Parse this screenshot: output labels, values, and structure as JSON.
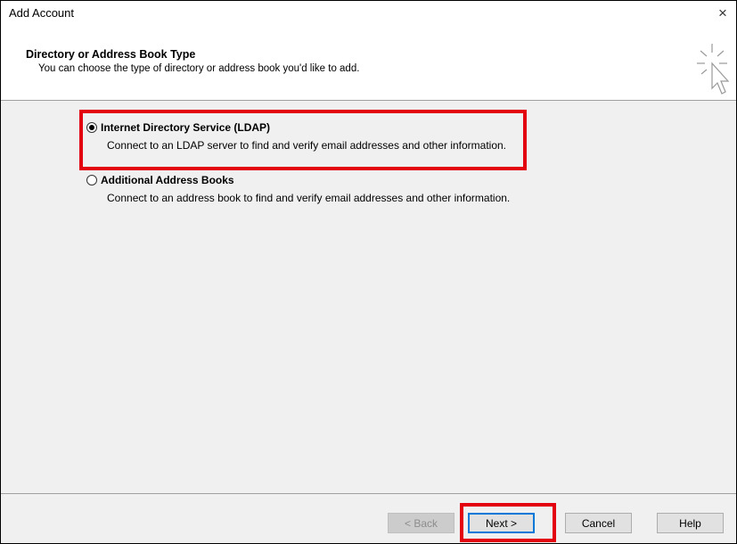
{
  "window": {
    "title": "Add Account",
    "close_symbol": "×"
  },
  "header": {
    "title": "Directory or Address Book Type",
    "subtitle": "You can choose the type of directory or address book you'd like to add."
  },
  "options": [
    {
      "label": "Internet Directory Service (LDAP)",
      "description": "Connect to an LDAP server to find and verify email addresses and other information.",
      "selected": true
    },
    {
      "label": "Additional Address Books",
      "description": "Connect to an address book to find and verify email addresses and other information.",
      "selected": false
    }
  ],
  "buttons": {
    "back": "< Back",
    "next": "Next >",
    "cancel": "Cancel",
    "help": "Help"
  },
  "colors": {
    "highlight": "#e3000f",
    "default_button_border": "#0078d7"
  }
}
